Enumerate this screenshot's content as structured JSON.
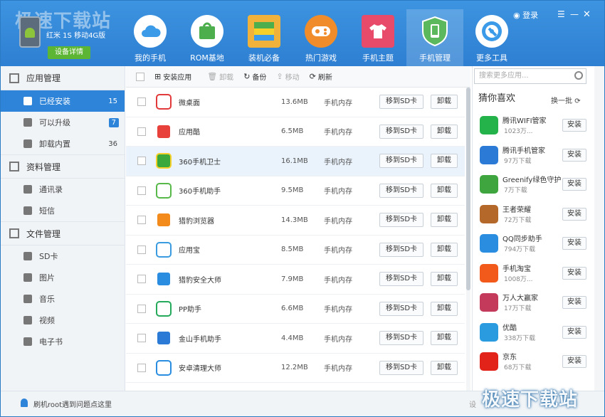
{
  "watermark": "极速下载站",
  "device": {
    "name": "红米 1S 移动4G版",
    "detail_button": "设备详情"
  },
  "window": {
    "login": "登录"
  },
  "nav": [
    {
      "label": "我的手机",
      "icon": "cloud-icon",
      "color": "#3b9be8"
    },
    {
      "label": "ROM基地",
      "icon": "rom-box-icon",
      "color": "#4cae4c"
    },
    {
      "label": "装机必备",
      "icon": "app-stack-icon",
      "color": "#f0b23a"
    },
    {
      "label": "热门游戏",
      "icon": "gamepad-icon",
      "color": "#f08c2a"
    },
    {
      "label": "手机主题",
      "icon": "shirt-icon",
      "color": "#e84a6a"
    },
    {
      "label": "手机管理",
      "icon": "shield-phone-icon",
      "color": "#5cb85c"
    },
    {
      "label": "更多工具",
      "icon": "wrench-icon",
      "color": "#3b9be8"
    }
  ],
  "sidebar": {
    "groups": [
      {
        "title": "应用管理",
        "items": [
          {
            "label": "已经安装",
            "count": "15",
            "active": true
          },
          {
            "label": "可以升级",
            "count": "7",
            "badge": true
          },
          {
            "label": "卸载内置",
            "count": "36"
          }
        ]
      },
      {
        "title": "资料管理",
        "items": [
          {
            "label": "通讯录"
          },
          {
            "label": "短信"
          }
        ]
      },
      {
        "title": "文件管理",
        "items": [
          {
            "label": "SD卡"
          },
          {
            "label": "图片"
          },
          {
            "label": "音乐"
          },
          {
            "label": "视频"
          },
          {
            "label": "电子书"
          }
        ]
      }
    ]
  },
  "toolbar": {
    "install": "安装应用",
    "uninstall": "卸载",
    "backup": "备份",
    "move": "移动",
    "refresh": "刷新"
  },
  "apps": [
    {
      "name": "微桌面",
      "size": "13.6MB",
      "loc": "手机内存",
      "color": "#ffffff",
      "accent": "#e23a3a"
    },
    {
      "name": "应用酷",
      "size": "6.5MB",
      "loc": "手机内存",
      "color": "#e8403a",
      "accent": "#ffffff"
    },
    {
      "name": "360手机卫士",
      "size": "16.1MB",
      "loc": "手机内存",
      "color": "#3aa83a",
      "accent": "#f5d02a"
    },
    {
      "name": "360手机助手",
      "size": "9.5MB",
      "loc": "手机内存",
      "color": "#ffffff",
      "accent": "#58b84a"
    },
    {
      "name": "猎豹浏览器",
      "size": "14.3MB",
      "loc": "手机内存",
      "color": "#f38a1c",
      "accent": "#ffffff"
    },
    {
      "name": "应用宝",
      "size": "8.5MB",
      "loc": "手机内存",
      "color": "#ffffff",
      "accent": "#3a9be0"
    },
    {
      "name": "猎豹安全大师",
      "size": "7.9MB",
      "loc": "手机内存",
      "color": "#2b8de0",
      "accent": "#ffffff"
    },
    {
      "name": "PP助手",
      "size": "6.6MB",
      "loc": "手机内存",
      "color": "#ffffff",
      "accent": "#25a95a"
    },
    {
      "name": "金山手机助手",
      "size": "4.4MB",
      "loc": "手机内存",
      "color": "#2b7ad6",
      "accent": "#ffffff"
    },
    {
      "name": "安卓清理大师",
      "size": "12.2MB",
      "loc": "手机内存",
      "color": "#ffffff",
      "accent": "#2b8de0"
    }
  ],
  "row_buttons": {
    "move_sd": "移到SD卡",
    "uninstall": "卸载"
  },
  "right": {
    "search_placeholder": "搜索更多应用...",
    "title": "猜你喜欢",
    "refresh": "换一批",
    "install": "安装",
    "items": [
      {
        "name": "腾讯WIFI管家",
        "count": "1023万...",
        "color": "#24b24a"
      },
      {
        "name": "腾讯手机管家",
        "count": "97万下载",
        "color": "#2b7ad6"
      },
      {
        "name": "Greenify绿色守护",
        "count": "7万下载",
        "color": "#3fa63f"
      },
      {
        "name": "王者荣耀",
        "count": "72万下载",
        "color": "#b4682a"
      },
      {
        "name": "QQ同步助手",
        "count": "794万下载",
        "color": "#2b8de0"
      },
      {
        "name": "手机淘宝",
        "count": "1008万...",
        "color": "#f25a1c"
      },
      {
        "name": "万人大赢家",
        "count": "17万下载",
        "color": "#c43a5a"
      },
      {
        "name": "优酷",
        "count": "338万下载",
        "color": "#2b9be0"
      },
      {
        "name": "京东",
        "count": "68万下载",
        "color": "#e2231a"
      }
    ]
  },
  "status": {
    "text": "刷机root遇到问题点这里",
    "right": "设"
  }
}
